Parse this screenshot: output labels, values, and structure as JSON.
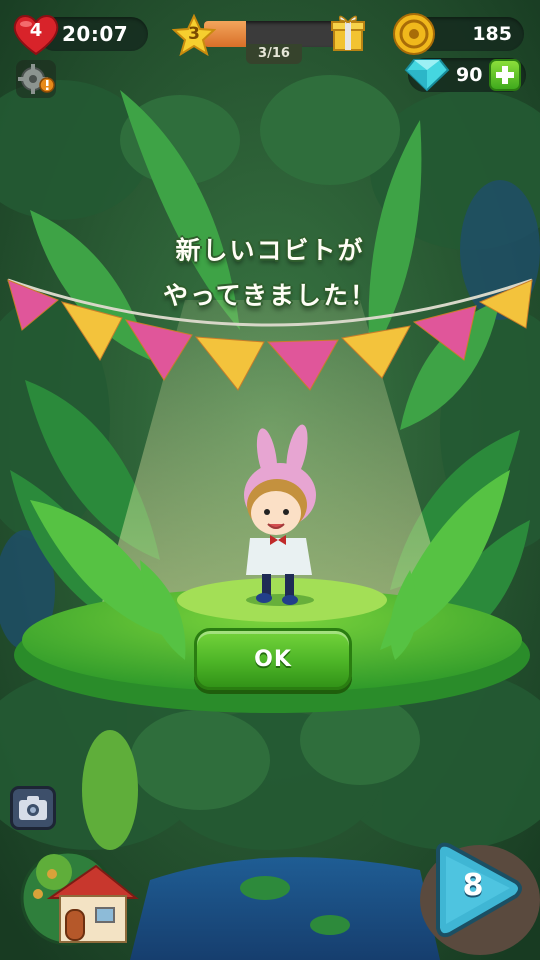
{
  "hud": {
    "lives": "4",
    "lives_timer": "20:07",
    "level": "3",
    "progress_label": "3/16",
    "progress_fraction": 0.3,
    "coins": "185",
    "gems": "90"
  },
  "dialog": {
    "line1": "新しいコビトが",
    "line2": "やってきました！",
    "ok_label": "OK"
  },
  "bottom": {
    "moves": "8"
  },
  "icons": [
    "heart-icon",
    "star-icon",
    "gift-icon",
    "coin-icon",
    "gem-icon",
    "plus-icon",
    "gear-icon",
    "alert-icon",
    "camera-icon",
    "house-icon",
    "moves-icon"
  ],
  "colors": {
    "ok_green": "#4db527",
    "bunting_pink": "#e0569a",
    "bunting_yellow": "#f3c33c",
    "progress_orange": "#e07c30"
  }
}
